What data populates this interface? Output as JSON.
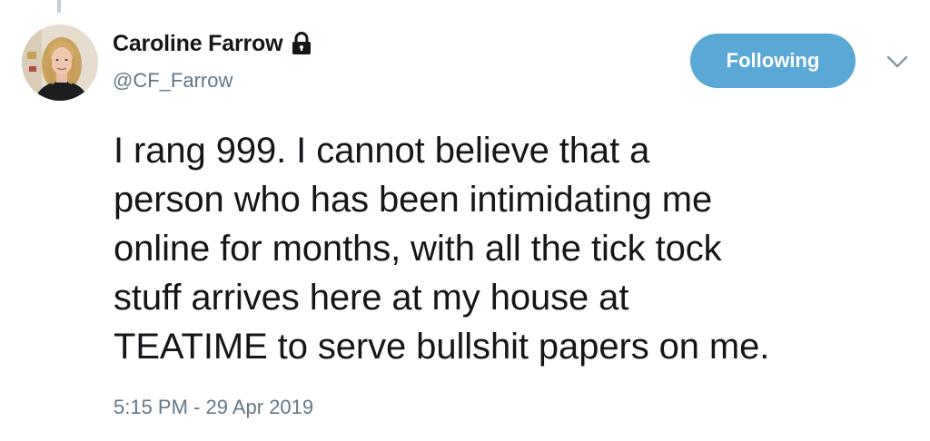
{
  "author": {
    "display_name": "Caroline Farrow",
    "handle": "@CF_Farrow",
    "protected_icon": "lock-icon",
    "avatar_icon": "profile-photo"
  },
  "follow_button": {
    "label": "Following",
    "color": "#5aa8d5"
  },
  "menu_icon": "chevron-down-icon",
  "tweet": {
    "lines": [
      "I rang 999. I cannot believe that a",
      "person who has been intimidating me",
      "online for months, with all the tick tock",
      "stuff arrives here at my house at",
      "TEATIME to serve bullshit papers on me."
    ],
    "timestamp": "5:15 PM - 29 Apr 2019"
  },
  "colors": {
    "text": "#14171a",
    "secondary": "#657786",
    "accent": "#5aa8d5"
  }
}
